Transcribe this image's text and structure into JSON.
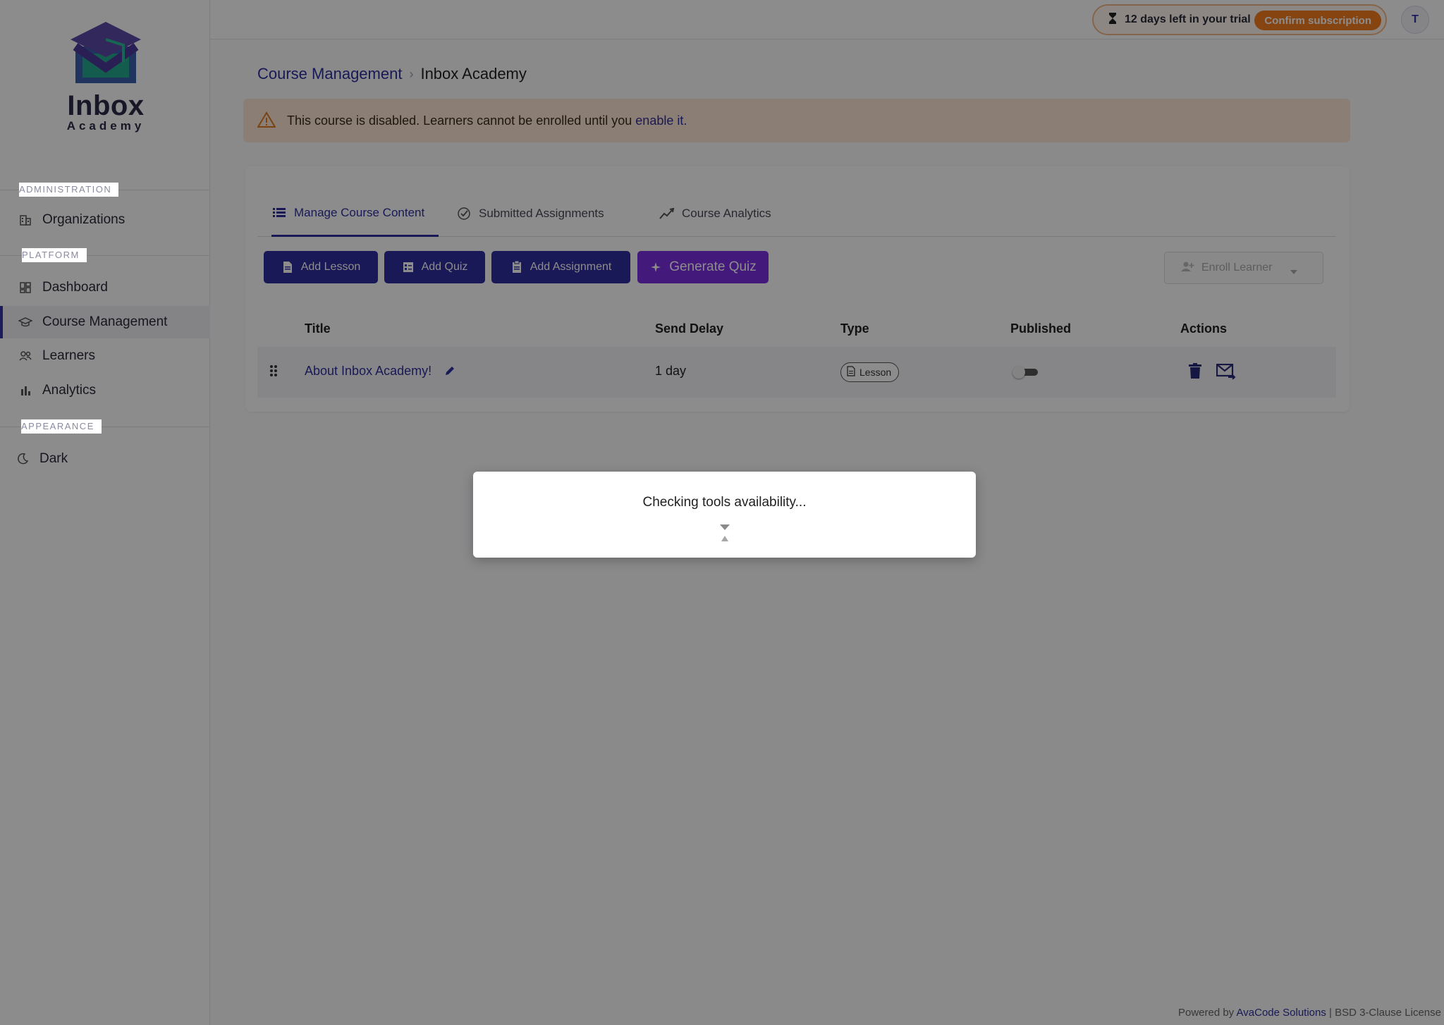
{
  "logo": {
    "brand": "Inbox",
    "sub": "Academy"
  },
  "sidebar": {
    "sections": [
      {
        "label": "ADMINISTRATION",
        "items": [
          {
            "label": "Organizations",
            "icon": "building-icon"
          }
        ]
      },
      {
        "label": "PLATFORM",
        "items": [
          {
            "label": "Dashboard",
            "icon": "dashboard-icon"
          },
          {
            "label": "Course Management",
            "icon": "graduation-cap-icon",
            "active": true
          },
          {
            "label": "Learners",
            "icon": "people-icon"
          },
          {
            "label": "Analytics",
            "icon": "bar-chart-icon"
          }
        ]
      },
      {
        "label": "APPEARANCE",
        "items": [
          {
            "label": "Dark",
            "icon": "moon-icon"
          }
        ]
      }
    ]
  },
  "topbar": {
    "trial_text": "12 days left in your trial",
    "confirm_label": "Confirm subscription",
    "avatar_initial": "T"
  },
  "breadcrumb": {
    "parent": "Course Management",
    "separator": "›",
    "current": "Inbox Academy"
  },
  "alert": {
    "text": "This course is disabled. Learners cannot be enrolled until you",
    "link": "enable it",
    "end": "."
  },
  "tabs": [
    {
      "label": "Manage Course Content",
      "icon": "list-icon",
      "active": true
    },
    {
      "label": "Submitted Assignments",
      "icon": "check-circle-icon"
    },
    {
      "label": "Course Analytics",
      "icon": "trend-icon"
    }
  ],
  "actions": {
    "add_lesson": "Add Lesson",
    "add_quiz": "Add Quiz",
    "add_assignment": "Add Assignment",
    "generate_quiz": "Generate Quiz",
    "enroll_learner": "Enroll Learner"
  },
  "table": {
    "headers": {
      "title": "Title",
      "send_delay": "Send Delay",
      "type": "Type",
      "published": "Published",
      "actions": "Actions"
    },
    "rows": [
      {
        "title": "About Inbox Academy!",
        "send_delay": "1 day",
        "type": "Lesson",
        "published": false
      }
    ]
  },
  "footer": {
    "prefix": "Powered by",
    "company": "AvaCode Solutions",
    "suffix": "| BSD 3-Clause License"
  },
  "modal": {
    "message": "Checking tools availability..."
  },
  "colors": {
    "primary": "#2e2ea0",
    "generate": "#7b2ee0",
    "trial_accent": "#f57c1f",
    "alert_bg": "#fde8d6"
  }
}
